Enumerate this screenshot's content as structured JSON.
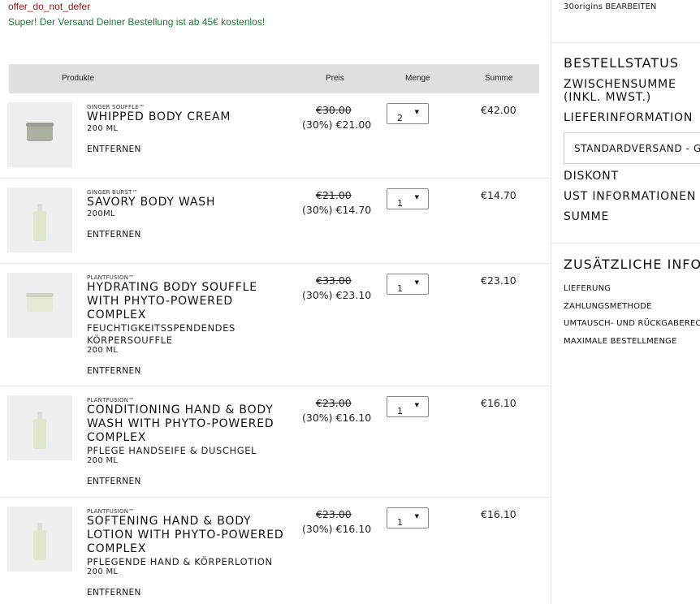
{
  "banner": {
    "offer_code": "offer_do_not_defer",
    "shipping_note": "Super! Der Versand Deiner Bestellung ist ab 45€ kostenlos!"
  },
  "cart": {
    "headers": {
      "product": "Produkte",
      "price": "Preis",
      "quantity": "Menge",
      "total": "Summe"
    },
    "remove_label": "ENTFERNEN",
    "items": [
      {
        "brand": "GINGER SOUFFLE™",
        "name": "WHIPPED BODY CREAM",
        "subtitle": "",
        "size": "200 ML",
        "old_price": "€30.00",
        "new_price": "(30%) €21.00",
        "qty": "2",
        "total": "€42.00",
        "image": "cream-jar-icon"
      },
      {
        "brand": "GINGER BURST™",
        "name": "SAVORY BODY WASH",
        "subtitle": "",
        "size": "200ML",
        "old_price": "€21.00",
        "new_price": "(30%) €14.70",
        "qty": "1",
        "total": "€14.70",
        "image": "pump-bottle-icon"
      },
      {
        "brand": "PLANTFUSION™",
        "name": "HYDRATING BODY SOUFFLE WITH PHYTO-POWERED COMPLEX",
        "subtitle": "FEUCHTIGKEITSSPENDENDES KÖRPERSOUFFLE",
        "size": "200 ML",
        "old_price": "€33.00",
        "new_price": "(30%) €23.10",
        "qty": "1",
        "total": "€23.10",
        "image": "souffle-jar-icon"
      },
      {
        "brand": "PLANTFUSION™",
        "name": "CONDITIONING HAND & BODY WASH WITH PHYTO-POWERED COMPLEX",
        "subtitle": "PFLEGE HANDSEIFE & DUSCHGEL",
        "size": "200 ML",
        "old_price": "€23.00",
        "new_price": "(30%) €16.10",
        "qty": "1",
        "total": "€16.10",
        "image": "pump-bottle-icon"
      },
      {
        "brand": "PLANTFUSION™",
        "name": "SOFTENING HAND & BODY LOTION WITH PHYTO-POWERED COMPLEX",
        "subtitle": "PFLEGENDE HAND & KÖRPERLOTION",
        "size": "200 ML",
        "old_price": "€23.00",
        "new_price": "(30%) €16.10",
        "qty": "1",
        "total": "€16.10",
        "image": "pump-bottle-icon"
      }
    ]
  },
  "sidebar": {
    "brand_name": "30origins",
    "edit_label": "BEARBEITEN",
    "order_status_title": "BESTELLSTATUS",
    "subtotal_label": "ZWISCHENSUMME (INKL. MWST.)",
    "delivery_info_label": "LIEFERINFORMATION",
    "shipping_option": "STANDARDVERSAND - G",
    "discount_label": "DISKONT",
    "vat_info_label": "UST INFORMATIONEN",
    "sum_label": "SUMME",
    "additional_info_title": "ZUSÄTZLICHE INFO",
    "info_links": [
      "LIEFERUNG",
      "ZAHLUNGSMETHODE",
      "UMTAUSCH- UND RÜCKGABERECHT",
      "MAXIMALE BESTELLMENGE"
    ]
  },
  "icons": {
    "dropdown_arrow": "▼"
  }
}
